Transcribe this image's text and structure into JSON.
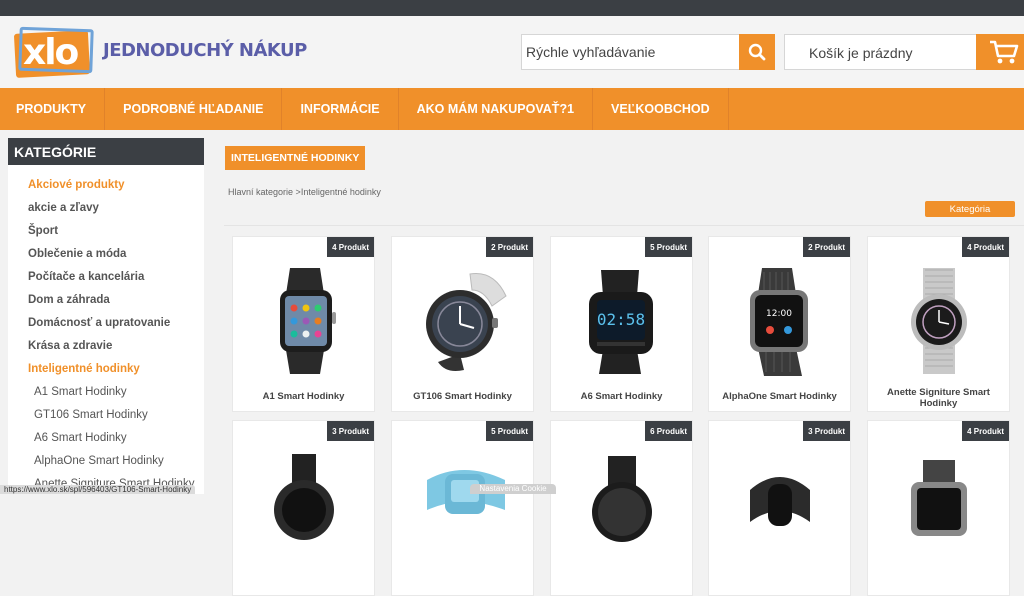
{
  "header": {
    "logo_text": "xlo",
    "tagline": "JEDNODUCHÝ NÁKUP",
    "search_placeholder": "Rýchle vyhľadávanie",
    "cart_label": "Košík je prázdny"
  },
  "nav": {
    "items": [
      {
        "label": "PRODUKTY"
      },
      {
        "label": "PODROBNÉ HĽADANIE"
      },
      {
        "label": "INFORMÁCIE"
      },
      {
        "label": "AKO MÁM NAKUPOVAŤ?1"
      },
      {
        "label": "VEĽKOOBCHOD"
      }
    ]
  },
  "sidebar": {
    "title": "KATEGÓRIE",
    "items": [
      {
        "label": "Akciové produkty"
      },
      {
        "label": "akcie a zľavy"
      },
      {
        "label": "Šport"
      },
      {
        "label": "Oblečenie a móda"
      },
      {
        "label": "Počítače a kancelária"
      },
      {
        "label": "Dom a záhrada"
      },
      {
        "label": "Domácnosť a upratovanie"
      },
      {
        "label": "Krása a zdravie"
      },
      {
        "label": "Inteligentné hodinky"
      },
      {
        "label": "A1 Smart Hodinky"
      },
      {
        "label": "GT106 Smart Hodinky"
      },
      {
        "label": "A6 Smart Hodinky"
      },
      {
        "label": "AlphaOne Smart Hodinky"
      },
      {
        "label": "Anette Signiture Smart Hodinky"
      }
    ]
  },
  "main": {
    "page_title": "INTELIGENTNÉ HODINKY",
    "breadcrumb_home": "Hlavní kategorie",
    "breadcrumb_sep": " >",
    "breadcrumb_current": "Inteligentné hodinky",
    "category_button": "Kategória"
  },
  "products": [
    {
      "badge": "4 Produkt",
      "name": "A1 Smart Hodinky"
    },
    {
      "badge": "2 Produkt",
      "name": "GT106 Smart Hodinky"
    },
    {
      "badge": "5 Produkt",
      "name": "A6 Smart Hodinky"
    },
    {
      "badge": "2 Produkt",
      "name": "AlphaOne Smart Hodinky"
    },
    {
      "badge": "4 Produkt",
      "name": "Anette Signiture Smart Hodinky"
    },
    {
      "badge": "3 Produkt",
      "name": ""
    },
    {
      "badge": "5 Produkt",
      "name": ""
    },
    {
      "badge": "6 Produkt",
      "name": ""
    },
    {
      "badge": "3 Produkt",
      "name": ""
    },
    {
      "badge": "4 Produkt",
      "name": ""
    }
  ],
  "status_url": "https://www.xlo.sk/spl/596403/GT106-Smart-Hodinky",
  "cookie_label": "Nastavenia Cookie",
  "colors": {
    "accent": "#f0902a",
    "dark": "#3b3f44",
    "brand_purple": "#5b5ea8",
    "logo_blue": "#6fa3d8"
  }
}
